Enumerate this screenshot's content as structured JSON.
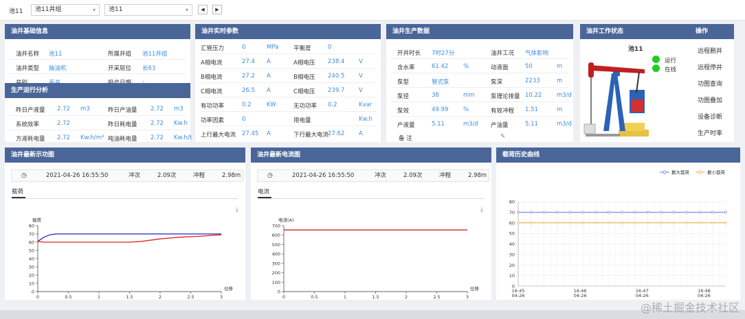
{
  "topbar": {
    "label": "池11",
    "select1": "池11井组",
    "select2": "池11",
    "prev": "◀",
    "next": "▶"
  },
  "basic_info": {
    "title": "油井基础信息",
    "rows": [
      {
        "l1": "油井名称",
        "v1": "池11",
        "l2": "所属井组",
        "v2": "池11井组"
      },
      {
        "l1": "油井类型",
        "v1": "抽油机",
        "l2": "开采层位",
        "v2": "长63"
      },
      {
        "l1": "井别",
        "v1": "直井",
        "l2": "投产日期",
        "v2": "-"
      }
    ]
  },
  "production_analysis": {
    "title": "生产运行分析",
    "rows": [
      {
        "l1": "昨日产液量",
        "v1": "2.72",
        "u1": "m3",
        "l2": "昨日产油量",
        "v2": "2.72",
        "u2": "m3"
      },
      {
        "l1": "系统效率",
        "v1": "2.72",
        "u1": "",
        "l2": "昨日耗电量",
        "v2": "2.72",
        "u2": "Kw.h"
      },
      {
        "l1": "方液耗电量",
        "v1": "2.72",
        "u1": "Kw.h/m³",
        "l2": "吨油耗电量",
        "v2": "2.72",
        "u2": "Kw.h/t"
      }
    ]
  },
  "realtime": {
    "title": "油井实时参数",
    "rows": [
      {
        "l1": "汇管压力",
        "v1": "0",
        "u1": "MPa",
        "l2": "平衡度",
        "v2": "0",
        "u2": ""
      },
      {
        "l1": "A相电流",
        "v1": "27.4",
        "u1": "A",
        "l2": "A相电压",
        "v2": "238.4",
        "u2": "V"
      },
      {
        "l1": "B相电流",
        "v1": "27.2",
        "u1": "A",
        "l2": "B相电压",
        "v2": "240.5",
        "u2": "V"
      },
      {
        "l1": "C相电流",
        "v1": "26.5",
        "u1": "A",
        "l2": "C相电压",
        "v2": "239.7",
        "u2": "V"
      },
      {
        "l1": "有功功率",
        "v1": "0.2",
        "u1": "KW",
        "l2": "无功功率",
        "v2": "0.2",
        "u2": "Kvar"
      },
      {
        "l1": "功率因素",
        "v1": "0",
        "u1": "",
        "l2": "用电量",
        "v2": "",
        "u2": "Kw.h"
      },
      {
        "l1": "上行最大电流",
        "v1": "27.45",
        "u1": "A",
        "l2": "下行最大电流",
        "v2": "27.62",
        "u2": "A"
      }
    ]
  },
  "production": {
    "title": "油井生产数据",
    "rows": [
      {
        "l1": "开井时长",
        "v1": "7时27分",
        "u1": "",
        "l2": "油井工况",
        "v2": "气体影响",
        "u2": ""
      },
      {
        "l1": "含水率",
        "v1": "61.42",
        "u1": "%",
        "l2": "动液面",
        "v2": "50",
        "u2": "m"
      },
      {
        "l1": "泵型",
        "v1": "管式泵",
        "u1": "",
        "l2": "泵深",
        "v2": "2233",
        "u2": "m"
      },
      {
        "l1": "泵径",
        "v1": "38",
        "u1": "mm",
        "l2": "泵理论排量",
        "v2": "10.22",
        "u2": "m3/d"
      },
      {
        "l1": "泵效",
        "v1": "49.99",
        "u1": "%",
        "l2": "有效冲程",
        "v2": "1.51",
        "u2": "m"
      },
      {
        "l1": "产液量",
        "v1": "5.11",
        "u1": "m3/d",
        "l2": "产油量",
        "v2": "5.11",
        "u2": "m3/d"
      }
    ],
    "remark_label": "备  注",
    "edit_icon": "✎"
  },
  "status": {
    "title": "油井工作状态",
    "well_name": "池11",
    "running": "运行",
    "online": "在线",
    "indicator_color": "#22cc22"
  },
  "operations": {
    "title": "操作",
    "items": [
      "远程删井",
      "远程停井",
      "功图查询",
      "功图叠加",
      "设备诊断",
      "生产时率"
    ]
  },
  "dyna_panel": {
    "title": "油井最新示功图",
    "time": "2021-04-26 16:55:50",
    "stroke_rate_label": "冲次",
    "stroke_rate": "2.09次",
    "stroke_len_label": "冲程",
    "stroke_len": "2.98m",
    "tab": "载荷"
  },
  "current_panel": {
    "title": "油井最新电流图",
    "time": "2021-04-26 16:55:50",
    "stroke_rate_label": "冲次",
    "stroke_rate": "2.09次",
    "stroke_len_label": "冲程",
    "stroke_len": "2.98m",
    "tab": "电流"
  },
  "load_panel": {
    "title": "载荷历史曲线"
  },
  "watermark": "@稀土掘金技术社区",
  "chart_data": [
    {
      "type": "line",
      "ylabel": "载荷",
      "xlabel": "位移",
      "xlim": [
        0,
        3
      ],
      "ylim": [
        0,
        80
      ],
      "xticks": [
        "0",
        "0.5",
        "1",
        "1.5",
        "2",
        "2.5",
        "3"
      ],
      "yticks": [
        "0",
        "10",
        "20",
        "30",
        "40",
        "50",
        "60",
        "70",
        "80"
      ],
      "series": [
        {
          "color": "#2222cc",
          "x": [
            0,
            0.1,
            0.2,
            0.3,
            0.5,
            1.0,
            1.5,
            2.0,
            2.5,
            3.0
          ],
          "y": [
            61,
            66,
            69,
            70,
            70,
            70,
            70,
            70,
            70,
            70
          ]
        },
        {
          "color": "#dd2222",
          "x": [
            0,
            0.1,
            0.3,
            0.5,
            1.0,
            1.5,
            1.7,
            2.0,
            2.3,
            2.6,
            3.0
          ],
          "y": [
            61,
            60,
            60,
            60,
            60,
            60,
            61,
            64,
            66,
            67,
            69
          ]
        }
      ]
    },
    {
      "type": "line",
      "ylabel": "电流(A)",
      "xlabel": "位移",
      "xlim": [
        0,
        3
      ],
      "ylim": [
        0,
        700
      ],
      "xticks": [
        "0",
        "0.5",
        "1",
        "1.5",
        "2",
        "2.5",
        "3"
      ],
      "yticks": [
        "0",
        "100",
        "200",
        "300",
        "400",
        "500",
        "600",
        "700"
      ],
      "series": [
        {
          "color": "#cc2222",
          "x": [
            0,
            3
          ],
          "y": [
            655,
            655
          ]
        }
      ]
    },
    {
      "type": "line",
      "ylim": [
        0,
        80
      ],
      "yticks": [
        "0",
        "10",
        "20",
        "30",
        "40",
        "50",
        "60",
        "70",
        "80"
      ],
      "xticks": [
        [
          "16:45",
          "04-26"
        ],
        [
          "16:46",
          "04-26"
        ],
        [
          "16:47",
          "04-26"
        ],
        [
          "16:48",
          "04-26"
        ]
      ],
      "xlim": [
        0,
        3.35
      ],
      "legend_position": "top-right",
      "series": [
        {
          "name": "最大载荷",
          "color": "#6677dd",
          "points": 17,
          "value": 70
        },
        {
          "name": "最小载荷",
          "color": "#f0a030",
          "points": 17,
          "value": 60
        }
      ]
    }
  ]
}
